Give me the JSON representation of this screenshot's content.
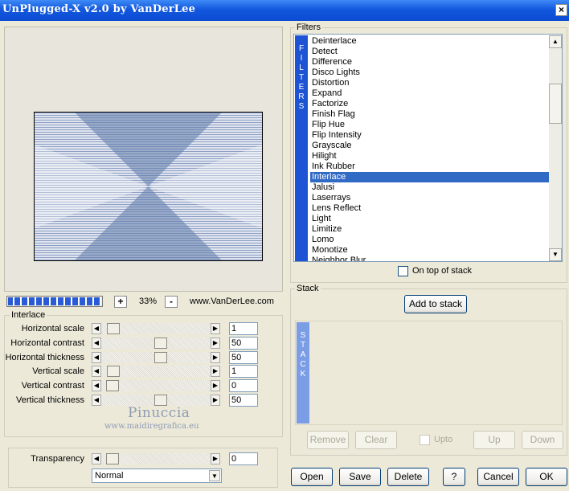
{
  "window": {
    "title": "UnPlugged-X v2.0 by VanDerLee",
    "close_glyph": "×"
  },
  "zoom": {
    "minus": "-",
    "plus": "+",
    "value": "33%"
  },
  "website": "www.VanDerLee.com",
  "interlace": {
    "legend": "Interlace",
    "controls": [
      {
        "label": "Horizontal scale",
        "value": "1",
        "level": 0.01
      },
      {
        "label": "Horizontal contrast",
        "value": "50",
        "level": 0.5
      },
      {
        "label": "Horizontal thickness",
        "value": "50",
        "level": 0.5
      },
      {
        "label": "Vertical scale",
        "value": "1",
        "level": 0.01
      },
      {
        "label": "Vertical contrast",
        "value": "0",
        "level": 0.0
      },
      {
        "label": "Vertical thickness",
        "value": "50",
        "level": 0.5
      }
    ]
  },
  "watermark": {
    "name": "Pinuccia",
    "site": "www.maidiregrafica.eu"
  },
  "transparency": {
    "label": "Transparency",
    "value": "0",
    "level": 0.0
  },
  "blend_mode": {
    "selected": "Normal"
  },
  "filters": {
    "legend": "Filters",
    "strip_letters": [
      "F",
      "I",
      "L",
      "T",
      "E",
      "R",
      "S"
    ],
    "items": [
      "Deinterlace",
      "Detect",
      "Difference",
      "Disco Lights",
      "Distortion",
      "Expand",
      "Factorize",
      "Finish Flag",
      "Flip Hue",
      "Flip Intensity",
      "Grayscale",
      "Hilight",
      "Ink Rubber",
      "Interlace",
      "Jalusi",
      "Laserrays",
      "Lens Reflect",
      "Light",
      "Limitize",
      "Lomo",
      "Monotize",
      "Neighbor Blur"
    ],
    "selected": "Interlace",
    "on_top_label": "On top of stack"
  },
  "stack": {
    "legend": "Stack",
    "add_label": "Add to stack",
    "strip_letters": [
      "S",
      "T",
      "A",
      "C",
      "K"
    ],
    "remove_label": "Remove",
    "clear_label": "Clear",
    "upto_label": "Upto",
    "up_label": "Up",
    "down_label": "Down"
  },
  "footer": {
    "open": "Open",
    "save": "Save",
    "delete": "Delete",
    "help": "?",
    "cancel": "Cancel",
    "ok": "OK"
  },
  "colors": {
    "title_bar": "#0b4cd3",
    "selection": "#316ac5",
    "filters_strip": "#1e54d4",
    "stack_strip": "#7b9de6"
  }
}
